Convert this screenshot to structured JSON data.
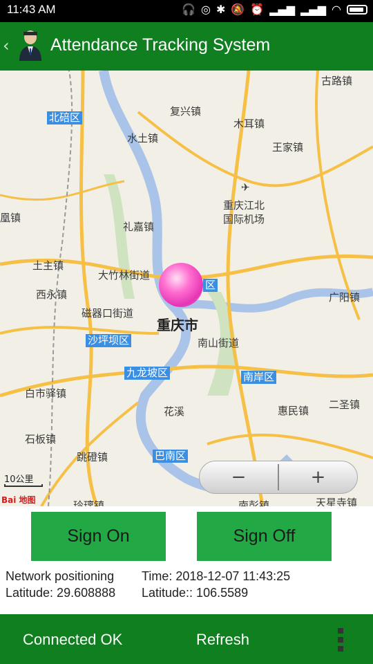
{
  "status_bar": {
    "time": "11:43  AM",
    "icons": [
      "headphones-icon",
      "sync-icon",
      "bluetooth-icon",
      "mute-icon",
      "alarm-icon",
      "signal-icon",
      "signal-icon",
      "wifi-icon",
      "battery-icon"
    ]
  },
  "app_bar": {
    "title": "Attendance Tracking System",
    "back_glyph": "‹"
  },
  "map": {
    "places": {
      "gulu": "古路镇",
      "beibei": "北碚区",
      "fuxing": "复兴镇",
      "muer": "木耳镇",
      "shuitu": "水土镇",
      "wangjia": "王家镇",
      "airport_1": "重庆江北",
      "airport_2": "国际机场",
      "fenghuang": "凰镇",
      "lijia": "礼嘉镇",
      "tuzhu": "土主镇",
      "dazhulin": "大竹林街道",
      "xiyong": "西永镇",
      "guangyang": "广阳镇",
      "ciqikou": "磁器口街道",
      "jiangbei": "区",
      "chongqing": "重庆市",
      "shapingba": "沙坪坝区",
      "nanshan": "南山街道",
      "jiulongpo": "九龙坡区",
      "nanan": "南岸区",
      "baishiyi": "白市驿镇",
      "huaxi": "花溪",
      "huimin": "惠民镇",
      "ersheng": "二圣镇",
      "shiban": "石板镇",
      "tiaodeng": "跳磴镇",
      "banan": "巴南区",
      "tianxing": "天星寺镇",
      "nanpeng": "南彭镇",
      "lingjiang": "玲璃镇"
    },
    "scale": "10公里",
    "logo": "Bai 地图",
    "zoom_out": "−",
    "zoom_in": "+"
  },
  "actions": {
    "sign_on": "Sign On",
    "sign_off": "Sign Off"
  },
  "info": {
    "mode": "Network positioning",
    "time": "Time: 2018-12-07 11:43:25",
    "latitude": "Latitude: 29.608888",
    "longitude": "Latitude:: 106.5589"
  },
  "bottom_bar": {
    "connected": "Connected OK",
    "refresh": "Refresh"
  },
  "colors": {
    "primary": "#0f7f1f",
    "button": "#22a845",
    "district_label": "#3b8fe3",
    "pin": "#e534b5"
  }
}
